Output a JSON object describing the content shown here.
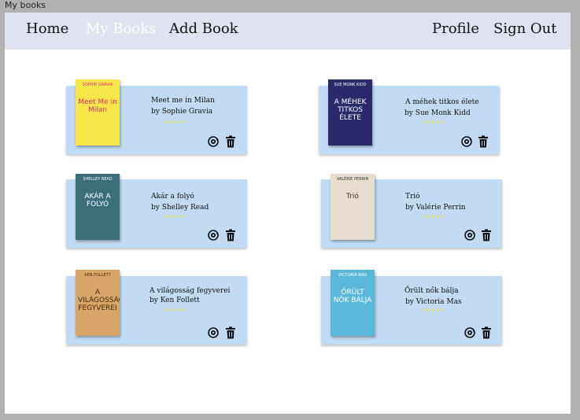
{
  "window": {
    "title": "My books"
  },
  "nav": {
    "home": "Home",
    "my_books": "My Books",
    "add_book": "Add Book",
    "profile": "Profile",
    "sign_out": "Sign Out"
  },
  "colors": {
    "navbar_bg": "#dfe3ef",
    "card_bg": "#c1dbf5",
    "active_nav": "#ffffff",
    "stars": "#f3e05a"
  },
  "books": [
    {
      "title": "Meet me in Milan",
      "author": "by Sophie Gravia",
      "stars": "★★★★★",
      "cover": {
        "author": "SOPHIE GRAVIA",
        "title": "Meet Me in Milan",
        "bg": "#f6e64a",
        "fg": "#e0306a"
      }
    },
    {
      "title": "A méhek titkos élete",
      "author": "by Sue Monk Kidd",
      "stars": "★★★★★",
      "cover": {
        "author": "SUE MONK KIDD",
        "title": "A MÉHEK TITKOS ÉLETE",
        "bg": "#2a2a6a",
        "fg": "#ffffff"
      }
    },
    {
      "title": "Akár a folyó",
      "author": "by Shelley Read",
      "stars": "★★★★★",
      "cover": {
        "author": "SHELLEY READ",
        "title": "AKÁR A FOLYÓ",
        "bg": "#3a6f7a",
        "fg": "#ffffff"
      }
    },
    {
      "title": "Trió",
      "author": "by Valérie Perrin",
      "stars": "★★★★★",
      "cover": {
        "author": "VALÉRIE PERRIN",
        "title": "Trió",
        "bg": "#e8ded0",
        "fg": "#333333"
      }
    },
    {
      "title": "A világosság fegyverei",
      "author": "by Ken Follett",
      "stars": "★★★★★",
      "cover": {
        "author": "KEN FOLLETT",
        "title": "A VILÁGOSSÁG FEGYVEREI",
        "bg": "#d6a567",
        "fg": "#4a2a10"
      }
    },
    {
      "title": "Őrült nők bálja",
      "author": "by Victoria Mas",
      "stars": "★★★★★",
      "cover": {
        "author": "VICTORIA MAS",
        "title": "ŐRÜLT NŐK BÁLJA",
        "bg": "#5ab8d8",
        "fg": "#ffffff"
      }
    }
  ],
  "icons": {
    "edit": "refresh-settings-icon",
    "delete": "trash-icon"
  }
}
